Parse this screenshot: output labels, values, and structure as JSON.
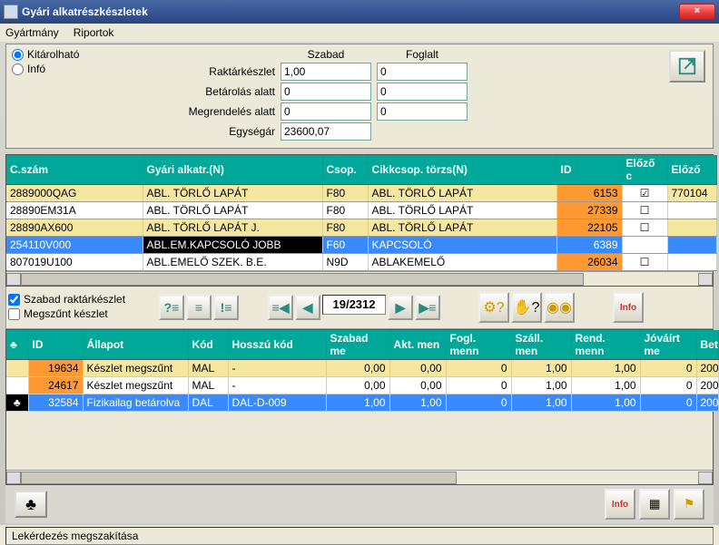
{
  "window": {
    "title": "Gyári alkatrészkészletek",
    "close": "×"
  },
  "menu": {
    "item1": "Gyártmány",
    "item2": "Riportok"
  },
  "radios": {
    "r1": "Kitárolható",
    "r2": "Infó"
  },
  "form": {
    "hdr_szabad": "Szabad",
    "hdr_foglalt": "Foglalt",
    "lbl_raktar": "Raktárkészlet",
    "lbl_betar": "Betárolás alatt",
    "lbl_megr": "Megrendelés alatt",
    "lbl_egyseg": "Egységár",
    "raktar_sz": "1,00",
    "raktar_f": "0",
    "betar_sz": "0",
    "betar_f": "0",
    "megr_sz": "0",
    "megr_f": "0",
    "egyseg": "23600,07"
  },
  "table1": {
    "headers": {
      "cszam": "C.szám",
      "alkatr": "Gyári alkatr.(N)",
      "csop": "Csop.",
      "cikk": "Cikkcsop. törzs(N)",
      "id": "ID",
      "elozo_c": "Előző c",
      "elozo": "Előző"
    },
    "rows": [
      {
        "cszam": "2889000QAG",
        "alkatr": "ABL. TÖRLŐ LAPÁT",
        "csop": "F80",
        "cikk": "ABL. TÖRLŐ LAPÁT",
        "id": "6153",
        "check": true,
        "elozo": "770104",
        "cls": "row-y"
      },
      {
        "cszam": "28890EM31A",
        "alkatr": "ABL. TÖRLŐ LAPÁT",
        "csop": "F80",
        "cikk": "ABL. TÖRLŐ LAPÁT",
        "id": "27339",
        "check": false,
        "elozo": "",
        "cls": "row-w"
      },
      {
        "cszam": "28890AX600",
        "alkatr": "ABL. TÖRLŐ LAPÁT J.",
        "csop": "F80",
        "cikk": "ABL. TÖRLŐ LAPÁT",
        "id": "22105",
        "check": false,
        "elozo": "",
        "cls": "row-y"
      },
      {
        "cszam": "254110V000",
        "alkatr": "ABL.EM.KAPCSOLÓ JOBB",
        "csop": "F60",
        "cikk": "KAPCSOLÓ",
        "id": "6389",
        "check": false,
        "elozo": "",
        "cls": "row-sel"
      },
      {
        "cszam": "807019U100",
        "alkatr": "ABL.EMELŐ SZEK. B.E.",
        "csop": "N9D",
        "cikk": "ABLAKEMELŐ",
        "id": "26034",
        "check": false,
        "elozo": "",
        "cls": "row-w"
      }
    ]
  },
  "checks": {
    "szabad": "Szabad raktárkészlet",
    "megszunt": "Megszűnt készlet"
  },
  "paging": {
    "text": "19/2312"
  },
  "table2": {
    "headers": {
      "club": "♣",
      "id": "ID",
      "allapot": "Állapot",
      "kod": "Kód",
      "hosszu": "Hosszú kód",
      "szabad": "Szabad me",
      "akt": "Akt. men",
      "fogl": "Fogl. menn",
      "szall": "Száll. men",
      "rend": "Rend. menn",
      "jovairt": "Jóváírt me",
      "bet": "Bet"
    },
    "rows": [
      {
        "club": "",
        "id": "19634",
        "allapot": "Készlet megszűnt",
        "kod": "MAL",
        "hosszu": "-",
        "szabad": "0,00",
        "akt": "0,00",
        "fogl": "0",
        "szall": "1,00",
        "rend": "1,00",
        "jovairt": "0",
        "bet": "200",
        "cls": "yrow"
      },
      {
        "club": "",
        "id": "24617",
        "allapot": "Készlet megszűnt",
        "kod": "MAL",
        "hosszu": "-",
        "szabad": "0,00",
        "akt": "0,00",
        "fogl": "0",
        "szall": "1,00",
        "rend": "1,00",
        "jovairt": "0",
        "bet": "200",
        "cls": "wrow"
      },
      {
        "club": "♣",
        "id": "32584",
        "allapot": "Fizikailag betárolva",
        "kod": "DAL",
        "hosszu": "DAL-D-009",
        "szabad": "1,00",
        "akt": "1,00",
        "fogl": "0",
        "szall": "1,00",
        "rend": "1,00",
        "jovairt": "0",
        "bet": "200",
        "cls": "srow"
      }
    ]
  },
  "status": {
    "text": "Lekérdezés megszakítása"
  },
  "icons": {
    "search": "?",
    "list": "≡",
    "prev": "◀",
    "next": "▶",
    "gear": "⚙",
    "hand": "✋",
    "coins": "◎",
    "info": "Info"
  }
}
